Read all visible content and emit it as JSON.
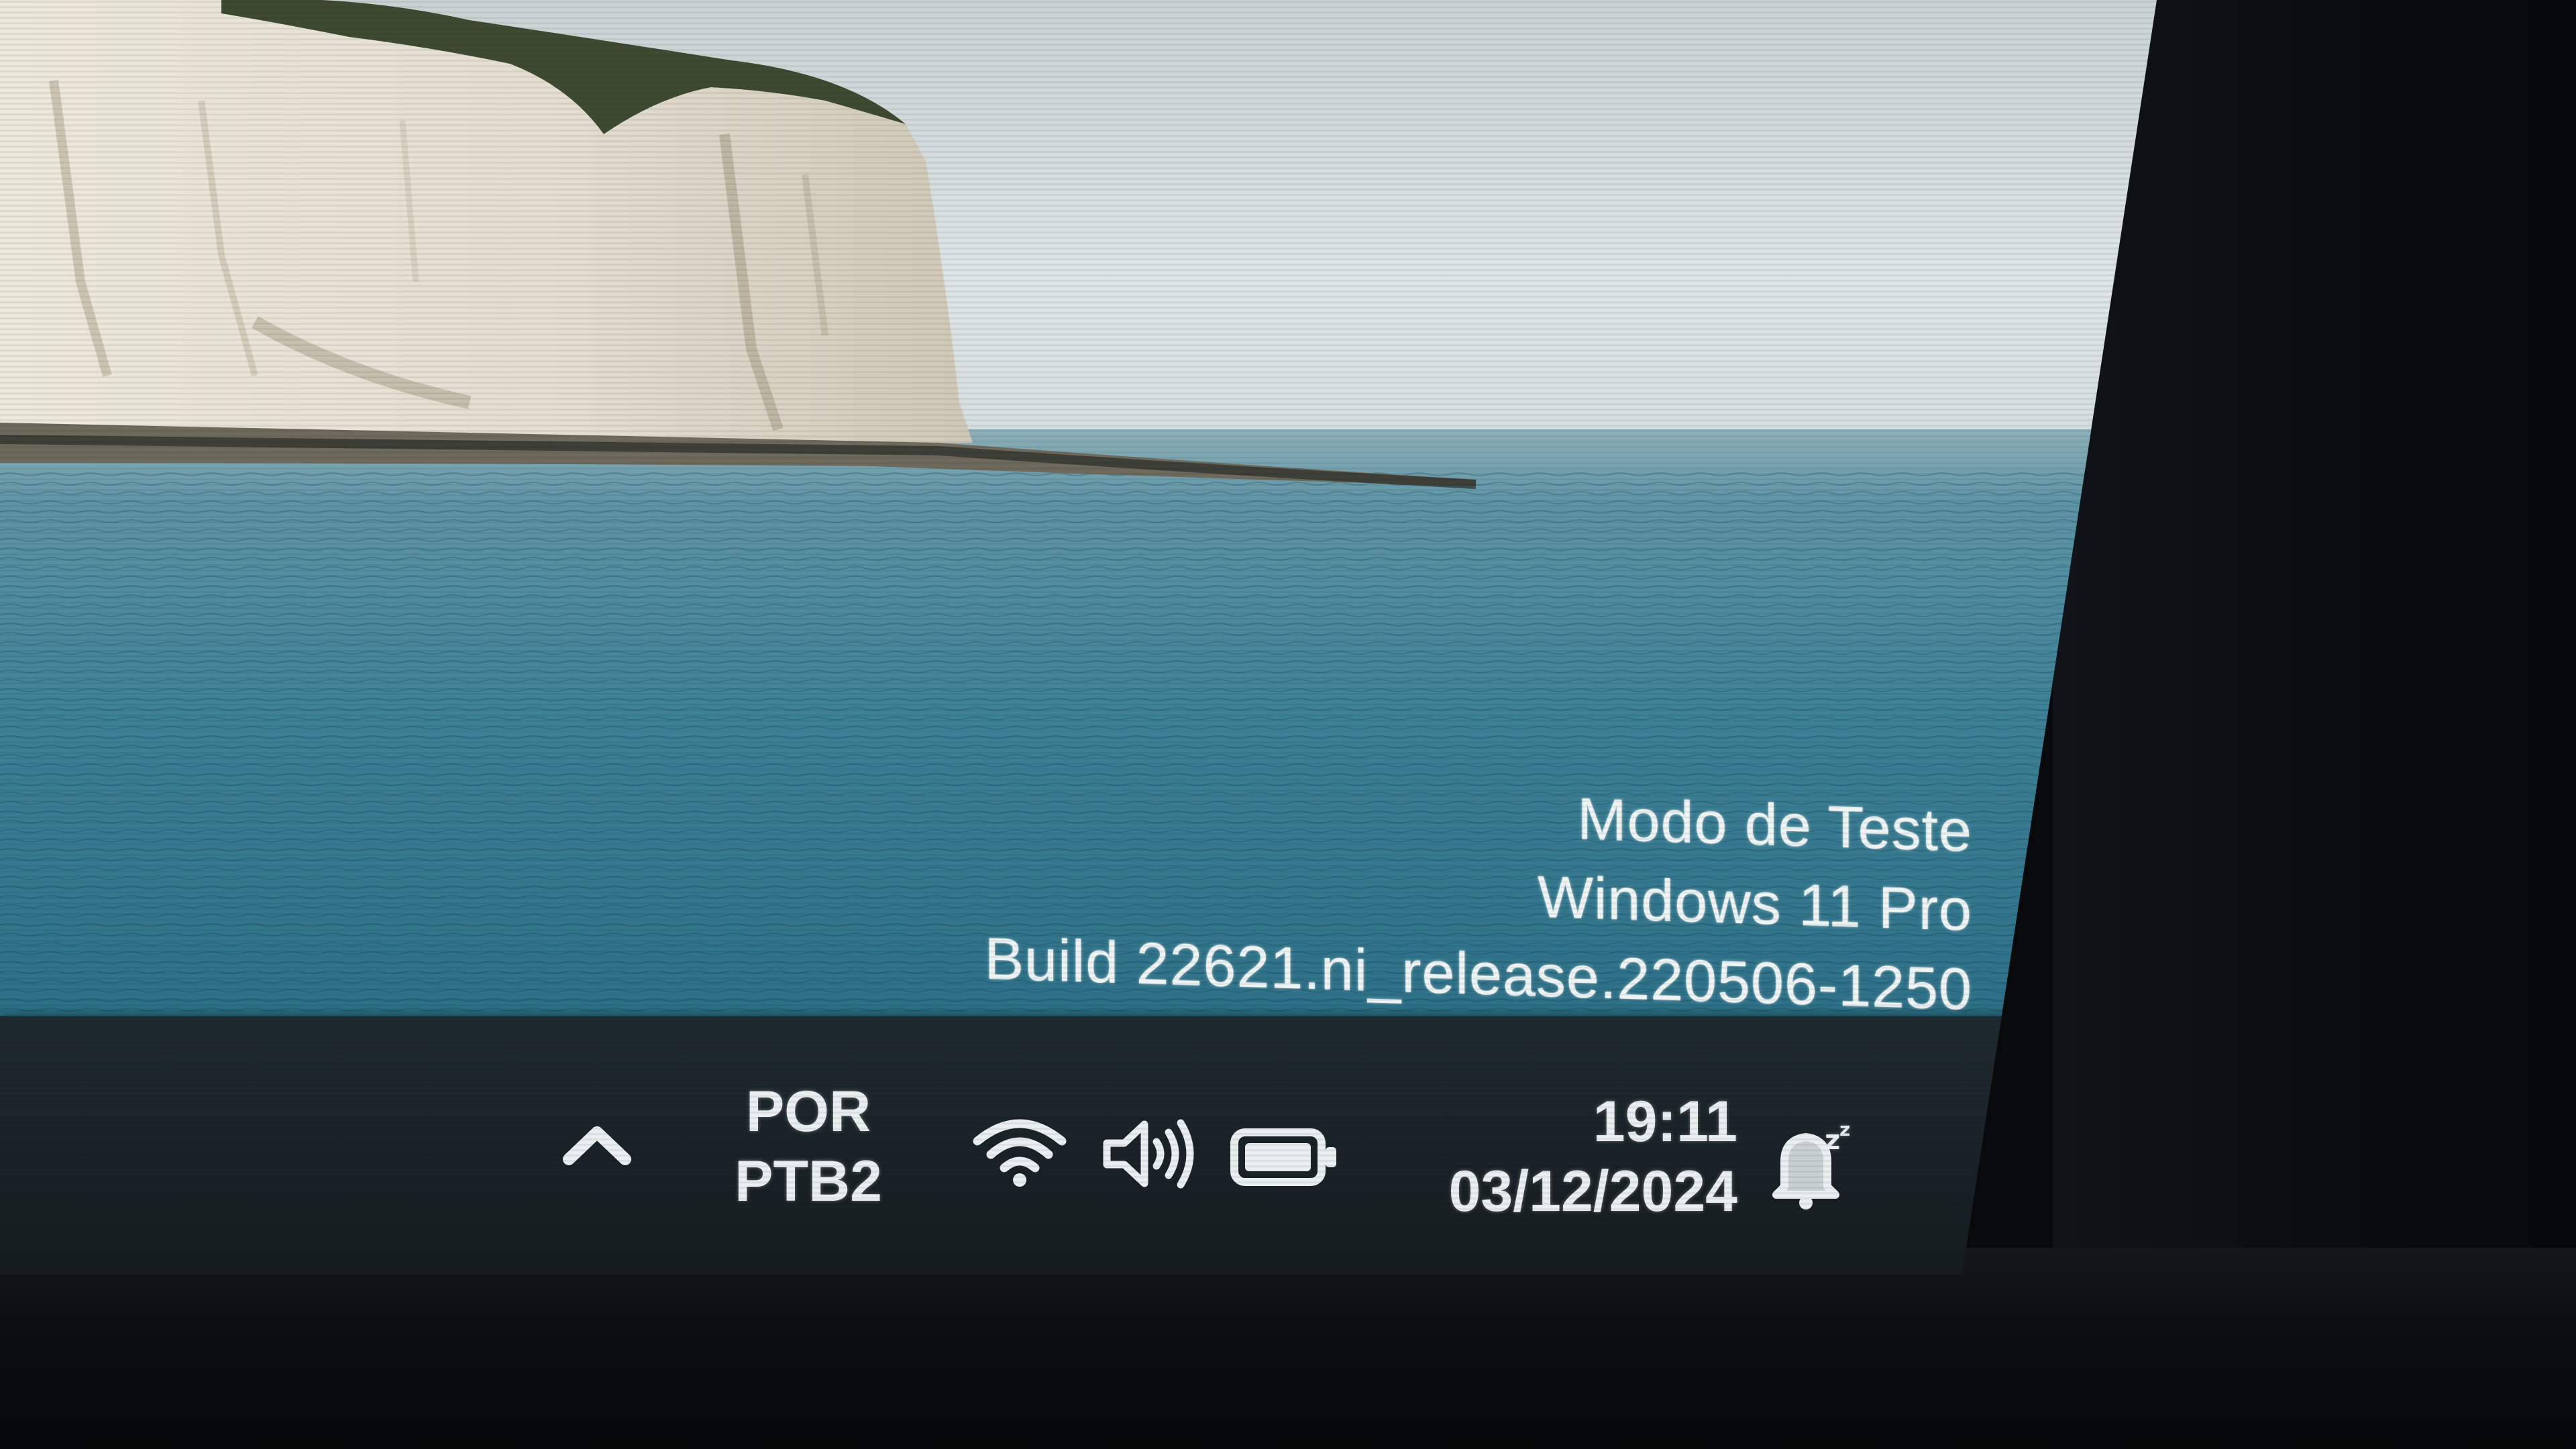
{
  "watermark": {
    "line1": "Modo de Teste",
    "line2": "Windows 11 Pro",
    "line3": "Build 22621.ni_release.220506-1250"
  },
  "taskbar": {
    "tray": {
      "overflow_icon": "chevron-up-icon",
      "language": {
        "line1": "POR",
        "line2": "PTB2"
      },
      "network_icon": "wifi-icon",
      "volume_icon": "volume-icon",
      "battery_icon": "battery-icon",
      "clock": {
        "time": "19:11",
        "date": "03/12/2024"
      },
      "notification_icon": "notification-bell-icon"
    }
  },
  "colors": {
    "taskbar_bg": "#1b2429",
    "tray_text": "#e9eef0",
    "sea": "#2f7288",
    "sky": "#d8e0e2",
    "cliff": "#e4e0d6"
  }
}
